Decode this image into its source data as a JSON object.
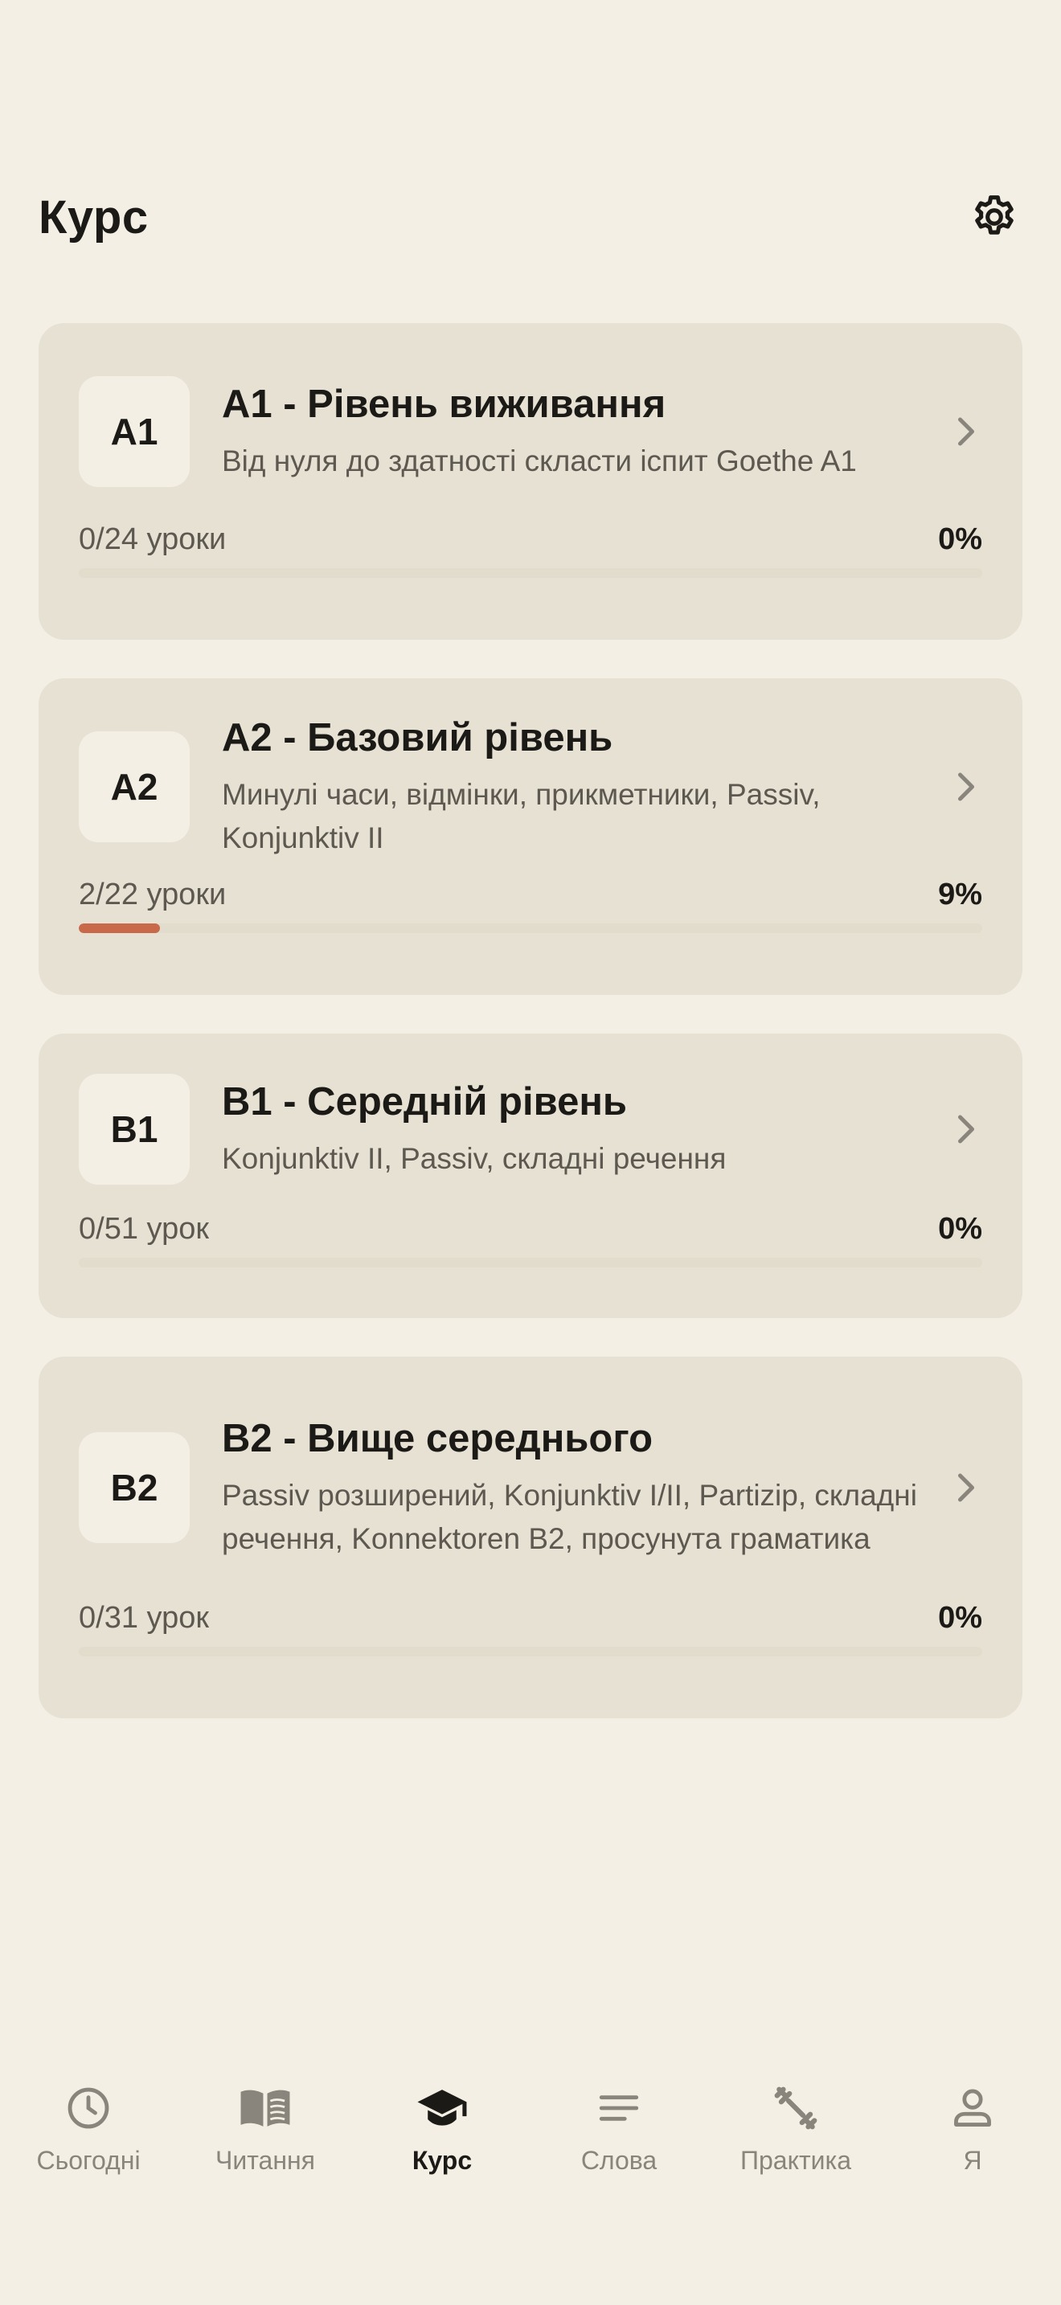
{
  "header": {
    "title": "Курс",
    "settings_icon": "gear-icon"
  },
  "colors": {
    "background": "#f3efe4",
    "card": "#e7e1d3",
    "accent": "#c8694a",
    "text": "#1c1a17",
    "muted": "#5d5850"
  },
  "courses": [
    {
      "badge": "A1",
      "title": "A1 - Рівень виживання",
      "description": "Від нуля до здатності скласти іспит Goethe A1",
      "lessons": "0/24 уроки",
      "percent_label": "0%",
      "progress": 0
    },
    {
      "badge": "A2",
      "title": "A2 - Базовий рівень",
      "description": "Минулі часи, відмінки, прикметники, Passiv, Konjunktiv II",
      "lessons": "2/22 уроки",
      "percent_label": "9%",
      "progress": 0.09
    },
    {
      "badge": "B1",
      "title": "B1 - Середній рівень",
      "description": "Konjunktiv II, Passiv, складні речення",
      "lessons": "0/51 урок",
      "percent_label": "0%",
      "progress": 0
    },
    {
      "badge": "B2",
      "title": "B2 - Вище середнього",
      "description": "Passiv розширений, Konjunktiv I/II, Partizip, складні речення, Konnektoren B2, просунута граматика",
      "lessons": "0/31 урок",
      "percent_label": "0%",
      "progress": 0
    }
  ],
  "tabs": [
    {
      "label": "Сьогодні",
      "icon": "clock-icon",
      "active": false
    },
    {
      "label": "Читання",
      "icon": "book-icon",
      "active": false
    },
    {
      "label": "Курс",
      "icon": "graduation-cap-icon",
      "active": true
    },
    {
      "label": "Слова",
      "icon": "lines-icon",
      "active": false
    },
    {
      "label": "Практика",
      "icon": "dumbbell-icon",
      "active": false
    },
    {
      "label": "Я",
      "icon": "person-icon",
      "active": false
    }
  ]
}
